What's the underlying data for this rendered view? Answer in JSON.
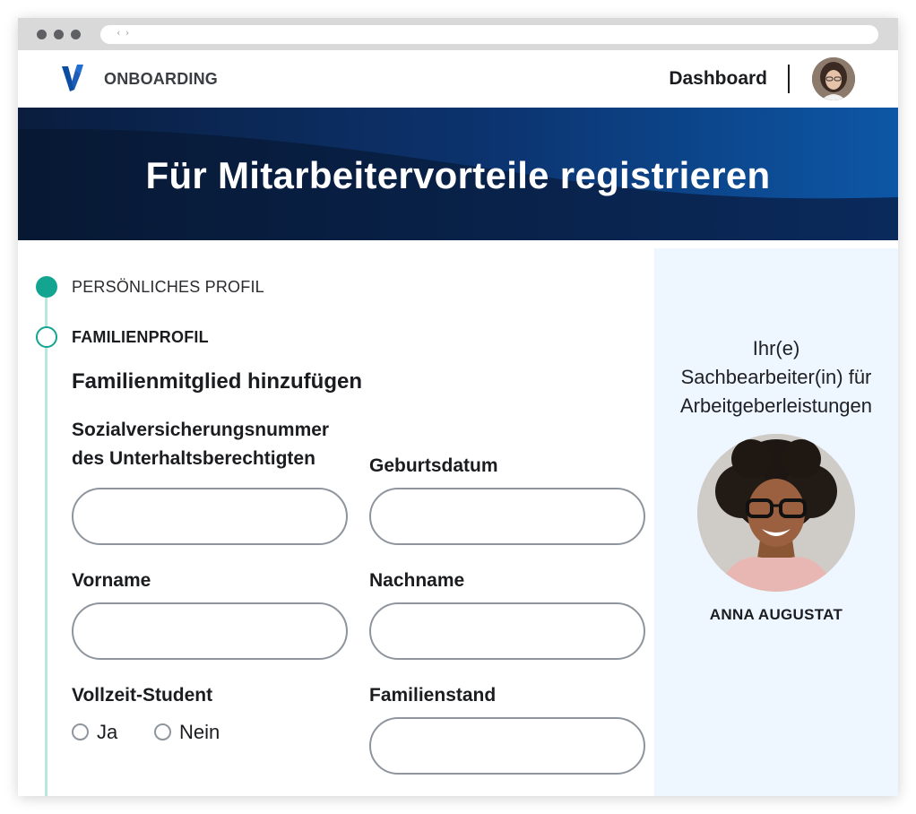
{
  "app": {
    "brand": "ONBOARDING",
    "nav_link": "Dashboard"
  },
  "hero": {
    "title": "Für Mitarbeitervorteile registrieren"
  },
  "steps": [
    {
      "label": "PERSÖNLICHES PROFIL",
      "state": "completed"
    },
    {
      "label": "FAMILIENPROFIL",
      "state": "current"
    }
  ],
  "form": {
    "section_title": "Familienmitglied hinzufügen",
    "fields": {
      "ssn_label_line1": "Sozialversicherungsnummer",
      "ssn_label_line2": "des Unterhaltsberechtigten",
      "ssn_value": "",
      "birthdate_label": "Geburtsdatum",
      "birthdate_value": "",
      "firstname_label": "Vorname",
      "firstname_value": "",
      "lastname_label": "Nachname",
      "lastname_value": "",
      "student_label": "Vollzeit-Student",
      "student_options": [
        "Ja",
        "Nein"
      ],
      "marital_label": "Familienstand",
      "marital_value": ""
    }
  },
  "agent": {
    "caption_line1": "Ihr(e)",
    "caption_line2": "Sachbearbeiter(in) für",
    "caption_line3": "Arbeitgeberleistungen",
    "name": "ANNA AUGUSTAT"
  },
  "colors": {
    "accent_teal": "#13a58f",
    "hero_dark": "#0b2247",
    "hero_blue": "#0d57a6",
    "side_panel": "#eef6ff"
  },
  "icons": {
    "logo": "v-logo-icon",
    "url_nav": "code-brackets-icon"
  }
}
